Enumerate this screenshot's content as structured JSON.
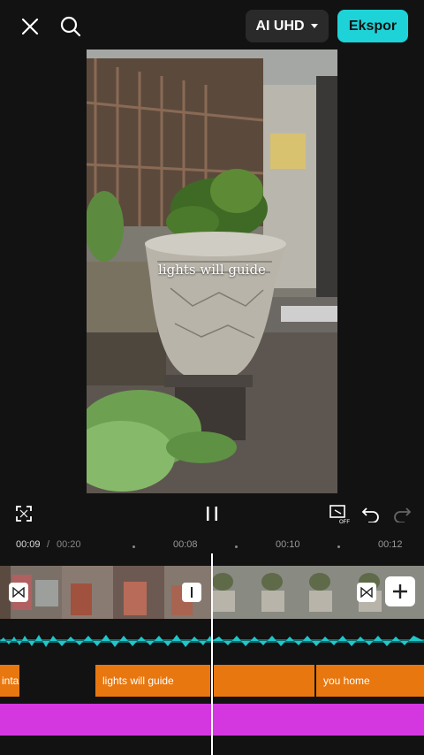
{
  "topbar": {
    "quality_label": "AI UHD",
    "export_label": "Ekspor"
  },
  "preview": {
    "overlay_text": "lights will guide"
  },
  "timeline": {
    "current_time": "00:09",
    "separator": "/",
    "total_time": "00:20",
    "ticks": [
      "00:08",
      "00:10",
      "00:12"
    ]
  },
  "text_clips": [
    {
      "label": "inta"
    },
    {
      "label": "lights will guide"
    },
    {
      "label": ""
    },
    {
      "label": "you home"
    }
  ],
  "colors": {
    "accent": "#1ed3d8",
    "audio": "#1fc7c9",
    "text_clip": "#e8770f",
    "effect_track": "#d437e0"
  },
  "icons": [
    "close-icon",
    "search-icon",
    "chevron-down-icon",
    "fullscreen-icon",
    "pause-icon",
    "preview-off-icon",
    "undo-icon",
    "redo-icon",
    "transition-icon",
    "add-icon"
  ]
}
